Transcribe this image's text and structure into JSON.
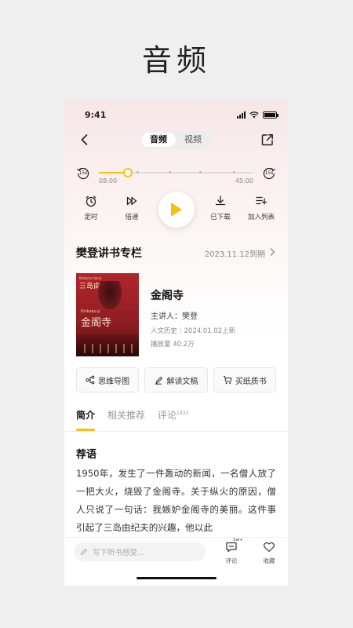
{
  "hero": {
    "title": "音频"
  },
  "status_bar": {
    "time": "9:41"
  },
  "nav": {
    "tabs": [
      {
        "label": "音频",
        "active": true
      },
      {
        "label": "视频",
        "active": false
      }
    ]
  },
  "player": {
    "skip_back": "15s",
    "skip_forward": "15s",
    "current_time": "08:00",
    "total_time": "45:00",
    "progress": 0.19,
    "accent_color": "#f4c20d",
    "controls": {
      "timer": "定时",
      "speed": "倍速",
      "downloaded": "已下载",
      "add_to_list": "加入列表"
    }
  },
  "album": {
    "title": "樊登讲书专栏",
    "date": "2023.11.12到期"
  },
  "book": {
    "cover": {
      "top_text": "Mishima Yukio",
      "author": "三岛由纪夫",
      "en_title": "Kinkaku-ji",
      "title": "金阁寺",
      "color": "#a52328"
    },
    "name": "金阁寺",
    "speaker": "主讲人：樊登",
    "meta": "人文历史｜2024.01.02上新",
    "plays": "播放量 40.2万"
  },
  "actions": [
    {
      "label": "思维导图",
      "icon": "mind-map-icon"
    },
    {
      "label": "解读文稿",
      "icon": "document-icon"
    },
    {
      "label": "买纸质书",
      "icon": "cart-icon"
    }
  ],
  "tabs": {
    "intro": "简介",
    "related": "相关推荐",
    "comments": "评论",
    "comments_count": "1433"
  },
  "intro": {
    "heading": "荐语",
    "body": "1950年，发生了一件轰动的新闻，一名僧人放了一把大火，烧毁了金阁寺。关于纵火的原因，僧人只说了一句话：我嫉妒金阁寺的美丽。这件事引起了三岛由纪夫的兴趣，他以此"
  },
  "bottom_bar": {
    "placeholder": "写下听书感受...",
    "comment_label": "评论",
    "comment_badge": "1w+",
    "favorite_label": "收藏"
  }
}
